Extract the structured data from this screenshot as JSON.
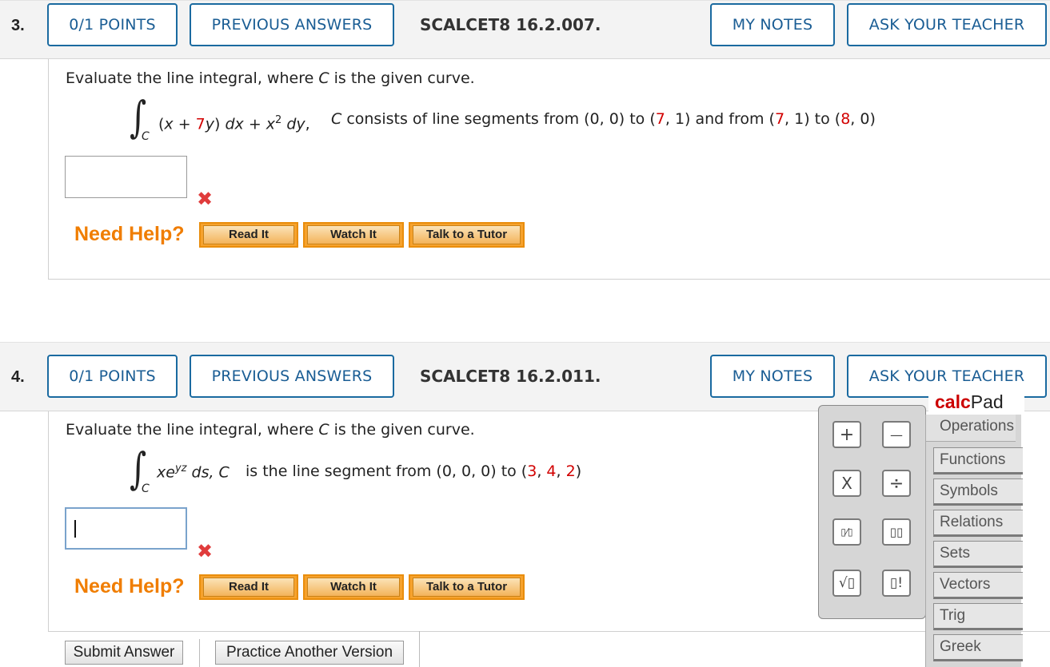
{
  "questions": [
    {
      "number": "3.",
      "points": "0/1 POINTS",
      "previous": "PREVIOUS ANSWERS",
      "ref": "SCALCET8 16.2.007.",
      "notes": "MY NOTES",
      "ask": "ASK YOUR TEACHER",
      "prompt_a": "Evaluate the line integral, where ",
      "prompt_c": "C",
      "prompt_b": " is the given curve.",
      "integral_sign": "∫",
      "integral_sub": "C",
      "expr": {
        "p1": "(",
        "x1": "x",
        "p2": " + ",
        "red1": "7",
        "y1": "y",
        "p3": ") ",
        "dx": "dx",
        "p4": " + ",
        "x2": "x",
        "sup": "2",
        "p5": " ",
        "dy": "dy",
        "p6": ","
      },
      "desc": {
        "c": "C",
        "t1": " consists of line segments from (0, 0) to (",
        "r1": "7",
        "t2": ", 1) and from (",
        "r2": "7",
        "t3": ", 1) to (",
        "r3": "8",
        "t4": ", 0)"
      },
      "answer_value": "",
      "incorrect_mark": "✖",
      "need_help": "Need Help?",
      "read_it": "Read It",
      "watch_it": "Watch It",
      "talk_tutor": "Talk to a Tutor"
    },
    {
      "number": "4.",
      "points": "0/1 POINTS",
      "previous": "PREVIOUS ANSWERS",
      "ref": "SCALCET8 16.2.011.",
      "notes": "MY NOTES",
      "ask": "ASK YOUR TEACHER",
      "prompt_a": "Evaluate the line integral, where ",
      "prompt_c": "C",
      "prompt_b": " is the given curve.",
      "integral_sign": "∫",
      "integral_sub": "C",
      "expr": {
        "x": "xe",
        "sup": "yz",
        "ds": " ds, ",
        "c": "C"
      },
      "desc": {
        "t1": "is the line segment from  (0, 0, 0) to (",
        "r1": "3",
        "t2": ", ",
        "r2": "4",
        "t3": ", ",
        "r3": "2",
        "t4": ")"
      },
      "answer_value": "",
      "incorrect_mark": "✖",
      "need_help": "Need Help?",
      "read_it": "Read It",
      "watch_it": "Watch It",
      "talk_tutor": "Talk to a Tutor"
    }
  ],
  "footer": {
    "submit": "Submit Answer",
    "practice": "Practice Another Version"
  },
  "calcpad": {
    "title_bold": "calc",
    "title_rest": "Pad",
    "keys": [
      "+",
      "—",
      "X",
      "÷",
      "▯⁄▯",
      "▯▯",
      "√▯",
      "▯!"
    ],
    "tabs": [
      "Operations",
      "Functions",
      "Symbols",
      "Relations",
      "Sets",
      "Vectors",
      "Trig",
      "Greek"
    ]
  }
}
